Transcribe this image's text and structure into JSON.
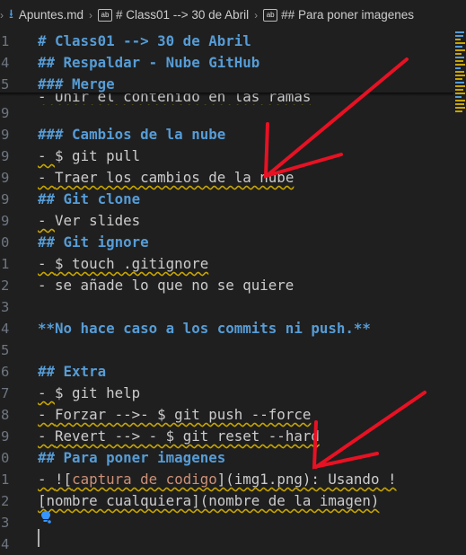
{
  "tabs": {
    "file": "Apuntes.md",
    "crumb1": "# Class01 --> 30 de Abril",
    "crumb2": "## Para poner imagenes",
    "file_icon": "markdown-download-icon",
    "crumb_icon": "symbol-icon"
  },
  "gutter": [
    "1",
    "4",
    "5",
    "9",
    "9",
    "9",
    "9",
    "9",
    "9",
    "0",
    "1",
    "2",
    "3",
    "4",
    "5",
    "6",
    "7",
    "8",
    "9",
    "0",
    "1",
    "2",
    "3",
    "4"
  ],
  "lines": {
    "l1": "# Class01 --> 30 de Abril",
    "l2": "## Respaldar - Nube GitHub",
    "l3": "### Merge",
    "l3b": "- Unir el contenido en las ramas",
    "l5": "### Cambios de la nube",
    "l6a": "- ",
    "l6b": "$ git pull",
    "l7a": "- ",
    "l7b": "Traer los cambios de la nube",
    "l8": "## Git clone",
    "l9a": "- ",
    "l9b": "Ver slides",
    "l10": "## Git ignore",
    "l11a": "- ",
    "l11b": "$ touch .gitignore",
    "l12": "- se añade lo que no se quiere",
    "l14": "**No hace caso a los commits ni push.**",
    "l16": "## Extra",
    "l17a": "- ",
    "l17b": "$ git help",
    "l18a": "- ",
    "l18b": "Forzar -->- $ git push --force",
    "l19a": "- ",
    "l19b": "Revert --> - $ git reset --hard",
    "l20": "## Para poner imagenes",
    "l21a": "- ",
    "l21b": "![",
    "l21c": "captura de codigo",
    "l21d": "](img1.png): Usando !",
    "l22": "[nombre cualquiera](nombre de la imagen)"
  },
  "colors": {
    "background": "#1f1f1f",
    "heading": "#569cd6",
    "text": "#cccccc",
    "squiggle": "#c7a500",
    "arrow": "#e81123",
    "link_text": "#ce9178"
  }
}
